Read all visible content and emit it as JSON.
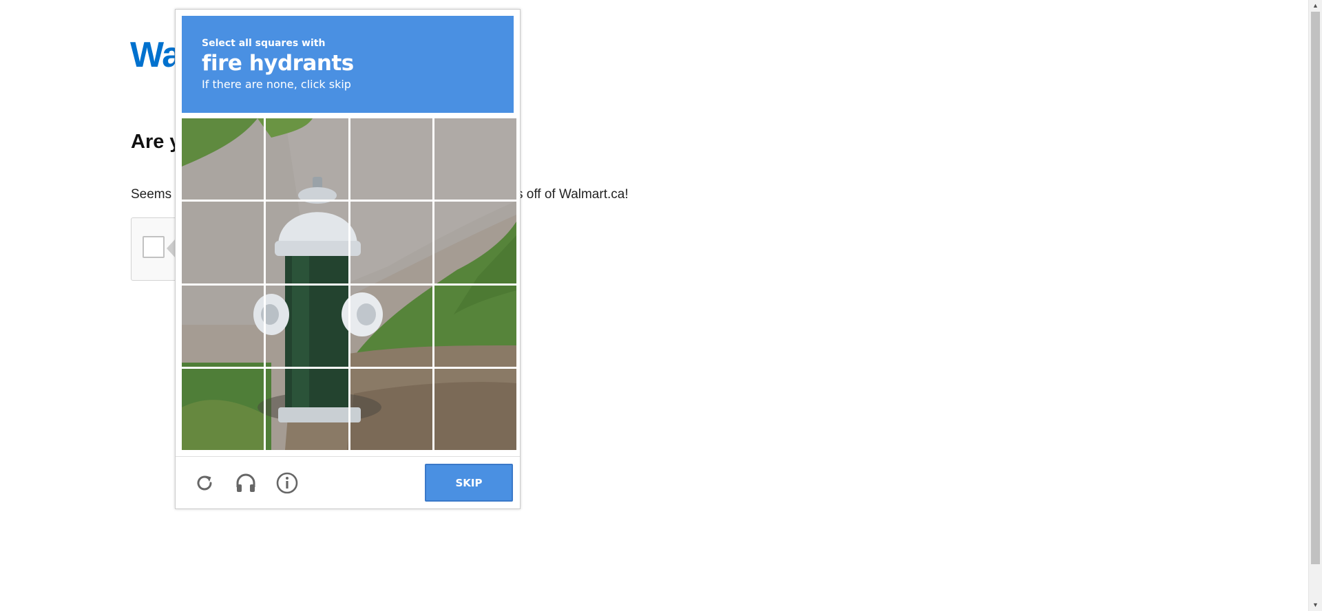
{
  "page": {
    "logo": "Wa",
    "heading": "Are y",
    "text_left": "Seems",
    "text_right": "s off of Walmart.ca!"
  },
  "captcha": {
    "instruction_line1": "Select all squares with",
    "target": "fire hydrants",
    "instruction_line3": "If there are none, click skip",
    "image_description_icon": "fire-hydrant-photo",
    "grid": {
      "rows": 4,
      "columns": 4
    },
    "skip_label": "SKIP",
    "icons": [
      "reload-icon",
      "audio-headphones-icon",
      "info-icon"
    ],
    "colors": {
      "header_blue": "#4a90e2",
      "logo_blue": "#0071ce"
    }
  }
}
